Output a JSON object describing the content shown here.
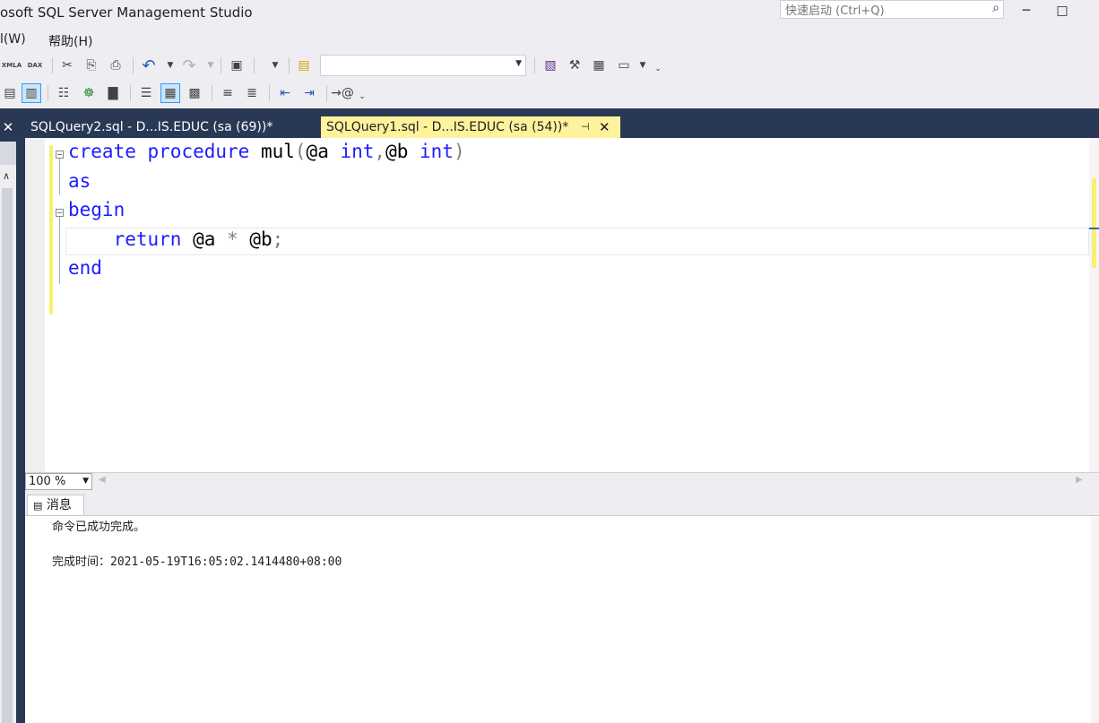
{
  "window": {
    "title": "osoft SQL Server Management Studio",
    "quick_launch_placeholder": "快速启动 (Ctrl+Q)",
    "minimize": "─",
    "maximize": "□"
  },
  "menu": [
    "l(W)",
    "帮助(H)"
  ],
  "toolbar1": {
    "xmla_label": "XMLA",
    "dax_label": "DAX",
    "database_selected": ""
  },
  "tabs": [
    {
      "label": "SQLQuery2.sql - D...IS.EDUC (sa (69))*",
      "active": false
    },
    {
      "label": "SQLQuery1.sql - D...IS.EDUC (sa (54))*",
      "active": true
    }
  ],
  "editor": {
    "lines": [
      {
        "tokens": [
          {
            "t": "create",
            "c": "kw"
          },
          {
            "t": " ",
            "c": ""
          },
          {
            "t": "procedure",
            "c": "kw"
          },
          {
            "t": " mul",
            "c": ""
          },
          {
            "t": "(",
            "c": "op"
          },
          {
            "t": "@a ",
            "c": ""
          },
          {
            "t": "int",
            "c": "kw"
          },
          {
            "t": ",",
            "c": "op"
          },
          {
            "t": "@b ",
            "c": ""
          },
          {
            "t": "int",
            "c": "kw"
          },
          {
            "t": ")",
            "c": "op"
          }
        ]
      },
      {
        "tokens": [
          {
            "t": "as",
            "c": "kw"
          }
        ]
      },
      {
        "tokens": [
          {
            "t": "begin",
            "c": "kw"
          }
        ]
      },
      {
        "tokens": [
          {
            "t": "    ",
            "c": ""
          },
          {
            "t": "return",
            "c": "kw"
          },
          {
            "t": " @a ",
            "c": ""
          },
          {
            "t": "*",
            "c": "op"
          },
          {
            "t": " @b",
            "c": ""
          },
          {
            "t": ";",
            "c": "op"
          }
        ]
      },
      {
        "tokens": [
          {
            "t": "end",
            "c": "kw"
          }
        ]
      }
    ],
    "zoom": "100 %"
  },
  "results": {
    "tab_label": "消息",
    "message": "命令已成功完成。",
    "completion_label": "完成时间：",
    "completion_time": "2021-05-19T16:05:02.1414480+08:00"
  },
  "colors": {
    "keyword": "#1d1dff",
    "operator": "#808080",
    "active_tab": "#fff29d",
    "doc_well": "#293955"
  }
}
